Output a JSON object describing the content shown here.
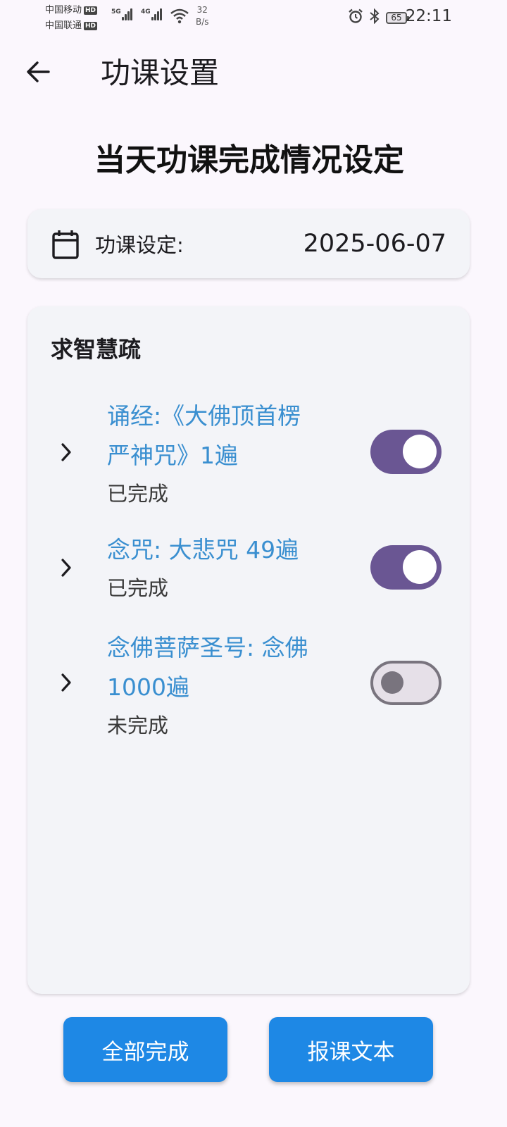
{
  "status_bar": {
    "carrier_1": "中国移动",
    "carrier_2": "中国联通",
    "hd_label": "HD",
    "signal_1_tag": "5G",
    "signal_2_tag": "4G",
    "net_speed_value": "32",
    "net_speed_unit": "B/s",
    "battery_level": "65",
    "time": "22:11",
    "icons": [
      "alarm-icon",
      "bluetooth-icon",
      "wifi-icon",
      "battery-icon"
    ]
  },
  "app_bar": {
    "back_icon": "arrow-left-icon",
    "title": "功课设置"
  },
  "heading": "当天功课完成情况设定",
  "date_card": {
    "icon": "calendar-icon",
    "label": "功课设定:",
    "value": "2025-06-07"
  },
  "section": {
    "title": "求智慧疏",
    "tasks": [
      {
        "title_line1": "诵经:《大佛顶首楞",
        "title_line2": "严神咒》1遍",
        "status": "已完成",
        "completed": true
      },
      {
        "title_line1": "念咒: 大悲咒 49遍",
        "status": "已完成",
        "completed": true
      },
      {
        "title_line1": "念佛菩萨圣号: 念佛",
        "title_line2": "1000遍",
        "status": "未完成",
        "completed": false
      }
    ]
  },
  "buttons": {
    "complete_all": "全部完成",
    "report_text": "报课文本"
  },
  "colors": {
    "background": "#fbf7fd",
    "card": "#f3f4f8",
    "task_title": "#3a8fd0",
    "switch_on": "#6a5693",
    "button": "#1e88e5"
  }
}
